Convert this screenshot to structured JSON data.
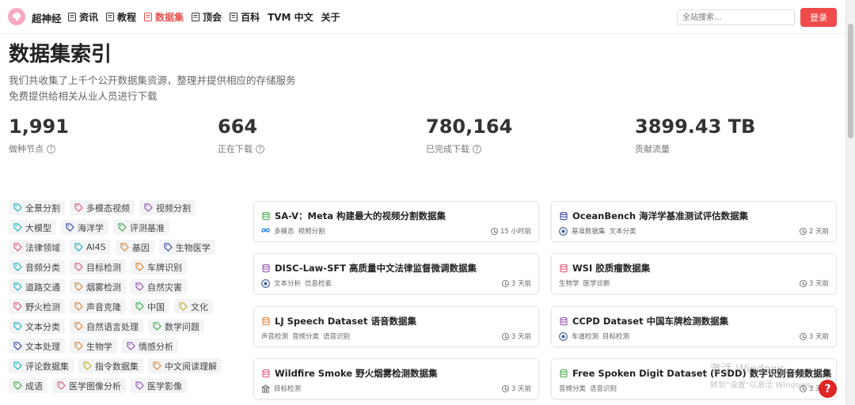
{
  "nav": {
    "brand": "超神经",
    "items": [
      {
        "label": "资讯",
        "active": false
      },
      {
        "label": "教程",
        "active": false
      },
      {
        "label": "数据集",
        "active": true
      },
      {
        "label": "顶会",
        "active": false
      },
      {
        "label": "百科",
        "active": false
      },
      {
        "label": "TVM 中文",
        "active": false
      },
      {
        "label": "关于",
        "active": false
      }
    ],
    "search_placeholder": "全站搜索...",
    "login_label": "登录"
  },
  "hero": {
    "title": "数据集索引",
    "subtitle1": "我们共收集了上千个公开数据集资源，整理并提供相应的存储服务",
    "subtitle2": "免费提供给相关从业人员进行下载"
  },
  "stats": [
    {
      "value": "1,991",
      "label": "做种节点",
      "help": true
    },
    {
      "value": "664",
      "label": "正在下载",
      "help": true
    },
    {
      "value": "780,164",
      "label": "已完成下载",
      "help": true
    },
    {
      "value": "3899.43 TB",
      "label": "贡献流量",
      "help": false
    }
  ],
  "tags": [
    [
      {
        "label": "全景分割",
        "color": "#2bb3c0"
      },
      {
        "label": "多模态视频",
        "color": "#e0607e"
      },
      {
        "label": "视频分割",
        "color": "#9b59b6"
      }
    ],
    [
      {
        "label": "大模型",
        "color": "#2bb3c0"
      },
      {
        "label": "海洋学",
        "color": "#3b4fa8"
      },
      {
        "label": "评测基准",
        "color": "#4caf50"
      }
    ],
    [
      {
        "label": "法律领域",
        "color": "#e0607e"
      },
      {
        "label": "AI4S",
        "color": "#2bb3c0"
      },
      {
        "label": "基因",
        "color": "#e08a3c"
      },
      {
        "label": "生物医学",
        "color": "#3b4fa8"
      }
    ],
    [
      {
        "label": "音频分类",
        "color": "#2bb3c0"
      },
      {
        "label": "目标检测",
        "color": "#e0607e"
      },
      {
        "label": "车牌识别",
        "color": "#e08a3c"
      }
    ],
    [
      {
        "label": "道路交通",
        "color": "#2bb3c0"
      },
      {
        "label": "烟雾检测",
        "color": "#e08a3c"
      },
      {
        "label": "自然灾害",
        "color": "#9b59b6"
      }
    ],
    [
      {
        "label": "野火检测",
        "color": "#e0607e"
      },
      {
        "label": "声音克隆",
        "color": "#e08a3c"
      },
      {
        "label": "中国",
        "color": "#4caf50"
      },
      {
        "label": "文化",
        "color": "#c8b030"
      }
    ],
    [
      {
        "label": "文本分类",
        "color": "#2bb3c0"
      },
      {
        "label": "自然语言处理",
        "color": "#e08a3c"
      },
      {
        "label": "数学问题",
        "color": "#4caf50"
      }
    ],
    [
      {
        "label": "文本处理",
        "color": "#3b4fa8"
      },
      {
        "label": "生物学",
        "color": "#e08a3c"
      },
      {
        "label": "情感分析",
        "color": "#9b59b6"
      }
    ],
    [
      {
        "label": "评论数据集",
        "color": "#2bb3c0"
      },
      {
        "label": "指令数据集",
        "color": "#c8b030"
      },
      {
        "label": "中文阅读理解",
        "color": "#e08a3c"
      }
    ],
    [
      {
        "label": "成语",
        "color": "#4caf50"
      },
      {
        "label": "医学图像分析",
        "color": "#e0607e"
      },
      {
        "label": "医学影像",
        "color": "#9b59b6"
      }
    ]
  ],
  "cards": [
    {
      "title": "SA-V：Meta 构建最大的视频分割数据集",
      "icon_color": "#4caf50",
      "meta_icon": "meta-logo-icon",
      "tags": [
        "多模态",
        "视频分割"
      ],
      "time": "15 小时前"
    },
    {
      "title": "OceanBench 海洋学基准测试评估数据集",
      "icon_color": "#3b4fa8",
      "meta_icon": "ocean-logo-icon",
      "tags": [
        "基准数据集",
        "文本分类"
      ],
      "time": "2 天前"
    },
    {
      "title": "DISC-Law-SFT 高质量中文法律监督微调数据集",
      "icon_color": "#9b59b6",
      "meta_icon": "university-logo-icon",
      "tags": [
        "文本分析",
        "信息检索"
      ],
      "time": "3 天前"
    },
    {
      "title": "WSI 胶质瘤数据集",
      "icon_color": "#e0607e",
      "meta_icon": "",
      "tags": [
        "生物学",
        "医学诊断"
      ],
      "time": "3 天前"
    },
    {
      "title": "LJ Speech Dataset 语音数据集",
      "icon_color": "#e08a3c",
      "meta_icon": "",
      "tags": [
        "声音检测",
        "音频分类",
        "语音识别"
      ],
      "time": "3 天前"
    },
    {
      "title": "CCPD Dataset 中国车牌检测数据集",
      "icon_color": "#9b59b6",
      "meta_icon": "university-logo-icon",
      "tags": [
        "车道检测",
        "目标检测"
      ],
      "time": "3 天前"
    },
    {
      "title": "Wildfire Smoke 野火烟雾检测数据集",
      "icon_color": "#e0607e",
      "meta_icon": "building-icon",
      "tags": [
        "目标检测"
      ],
      "time": "3 天前"
    },
    {
      "title": "Free Spoken Digit Dataset (FSDD) 数字识别音频数据集",
      "icon_color": "#4caf50",
      "meta_icon": "",
      "tags": [
        "音频分类",
        "语音识别"
      ],
      "time": "3 天前"
    }
  ],
  "watermark": {
    "line1": "激活 Windows",
    "line2": "转到\"设置\"以激活 Windows。"
  },
  "help_bubble": "?"
}
